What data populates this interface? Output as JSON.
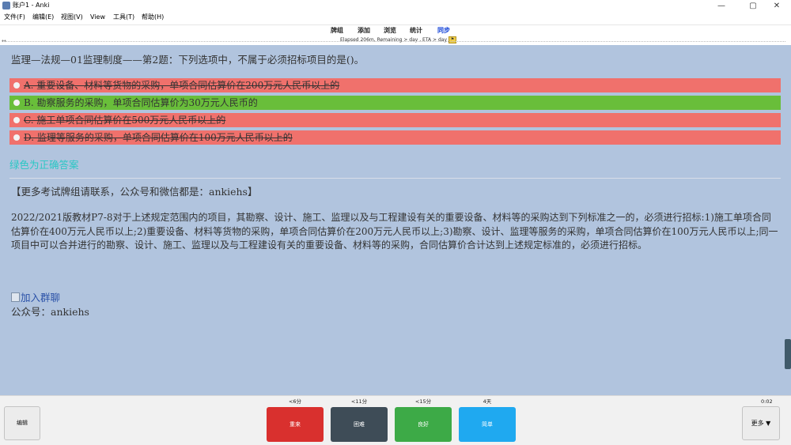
{
  "window": {
    "title": "账户1 - Anki",
    "minimize_glyph": "—",
    "maximize_glyph": "▢",
    "close_glyph": "✕",
    "app_icon": "anki-icon"
  },
  "menu": {
    "items": [
      "文件(F)",
      "编辑(E)",
      "视图(V)",
      "View",
      "工具(T)",
      "帮助(H)"
    ]
  },
  "toolbar": {
    "decks": "牌组",
    "add": "添加",
    "browse": "浏览",
    "stats": "统计",
    "sync": "同步",
    "eta": "Elapsed 206m, Remaining > day , ETA > day",
    "eta_badge": "⚑"
  },
  "card": {
    "question": "监理—法规—01监理制度——第2题：下列选项中，不属于必须招标项目的是()。",
    "options": [
      {
        "text": "A. 重要设备、材料等货物的采购，单项合同估算价在200万元人民币以上的",
        "state": "wrong"
      },
      {
        "text": "B. 勘察服务的采购，单项合同估算价为30万元人民币的",
        "state": "right"
      },
      {
        "text": "C. 施工单项合同估算价在500万元人民币以上的",
        "state": "wrong"
      },
      {
        "text": "D. 监理等服务的采购，单项合同估算价在100万元人民币以上的",
        "state": "wrong"
      }
    ],
    "green_note": "绿色为正确答案",
    "contact": "【更多考试牌组请联系，公众号和微信都是：ankiehs】",
    "explanation": "2022/2021版教材P7-8对于上述规定范围内的项目，其勘察、设计、施工、监理以及与工程建设有关的重要设备、材料等的采购达到下列标准之一的，必须进行招标:1)施工单项合同估算价在400万元人民币以上;2)重要设备、材料等货物的采购，单项合同估算价在200万元人民币以上;3)勘察、设计、监理等服务的采购，单项合同估算价在100万元人民币以上;同一项目中可以合并进行的勘察、设计、施工、监理以及与工程建设有关的重要设备、材料等的采购，合同估算价合计达到上述规定标准的，必须进行招标。",
    "join_link": "加入群聊",
    "public_account": "公众号：ankiehs"
  },
  "bottom": {
    "edit": "编辑",
    "more": "更多 ▼",
    "timer": "0:02",
    "buttons": [
      {
        "label": "重来",
        "interval": "<6分",
        "color": "#d9302e"
      },
      {
        "label": "困难",
        "interval": "<11分",
        "color": "#3e4c57"
      },
      {
        "label": "良好",
        "interval": "<15分",
        "color": "#3daa47"
      },
      {
        "label": "简单",
        "interval": "4天",
        "color": "#1fa9f0"
      }
    ]
  },
  "colors": {
    "card_bg": "#b1c4de",
    "wrong_bg": "#f0716c",
    "right_bg": "#69be3a",
    "note_text": "#29c7c4"
  }
}
